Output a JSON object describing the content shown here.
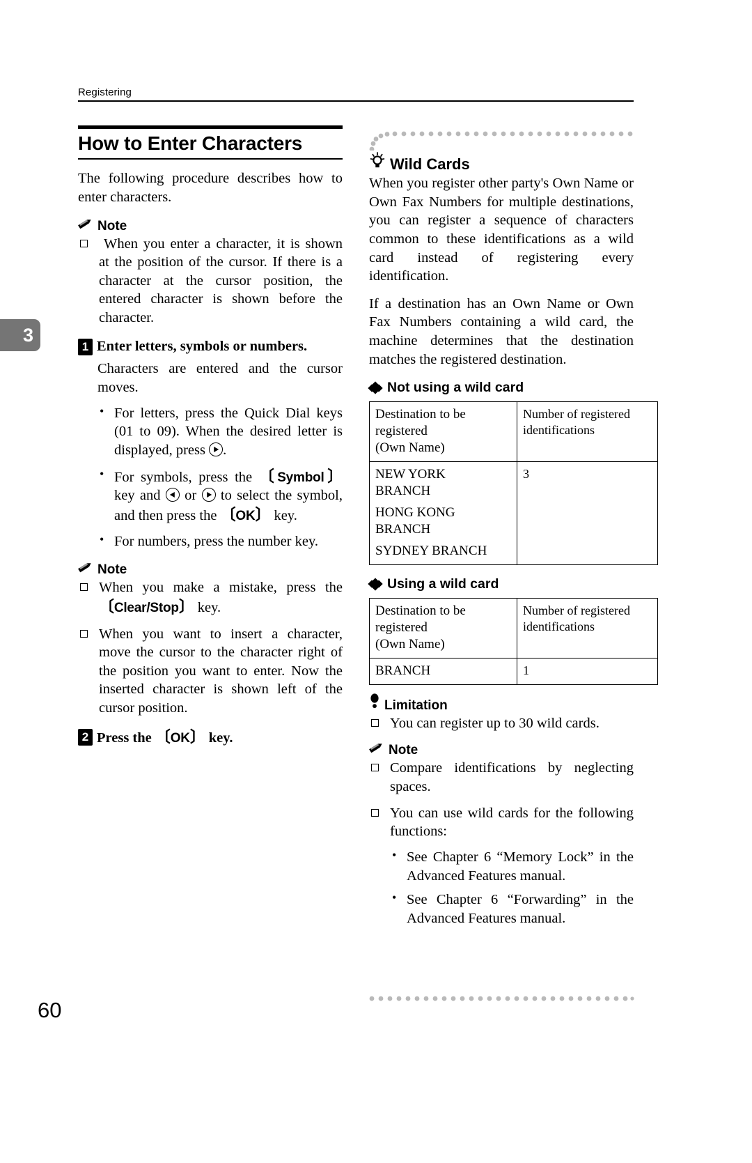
{
  "page": {
    "running_header": "Registering",
    "chapter_tab": "3",
    "folio": "60"
  },
  "left_column": {
    "section_title": "How to Enter Characters",
    "intro": "The following procedure describes how to enter characters.",
    "note1": {
      "label": "Note",
      "icon": "pencil-icon",
      "items": [
        "When you enter a character, it is shown at the position of the cursor. If there is a character at the cursor position, the entered character is shown before the character."
      ]
    },
    "step1": {
      "number": "1",
      "title": "Enter letters, symbols or numbers.",
      "body": "Characters are entered and the cursor moves.",
      "bullets": [
        {
          "part1": "For letters, press the Quick Dial keys (01 to 09). When the desired letter is displayed, press ",
          "icon": "circled-right-arrow-icon",
          "part2": "."
        },
        {
          "part1": "For symbols, press the ",
          "key1": "Symbol",
          "part2": " key and ",
          "icon1": "circled-left-arrow-icon",
          "part3": " or ",
          "icon2": "circled-right-arrow-icon",
          "part4": " to select the symbol, and then press the ",
          "key2": "OK",
          "part5": " key."
        },
        {
          "part1": "For numbers, press the number key."
        }
      ]
    },
    "note2": {
      "label": "Note",
      "icon": "pencil-icon",
      "items": [
        {
          "part1": "When you make a mistake, press the ",
          "key": "Clear/Stop",
          "part2": " key."
        },
        {
          "part1": "When you want to insert a character, move the cursor to the character right of the position you want to enter. Now the inserted character is shown left of the cursor position."
        }
      ]
    },
    "step2": {
      "number": "2",
      "title_part1": "Press the ",
      "title_key": "OK",
      "title_part2": " key."
    }
  },
  "right_column": {
    "tip": {
      "icon": "lightbulb-icon",
      "title": "Wild Cards",
      "paragraphs": [
        "When you register other party's Own Name or Own Fax Numbers for multiple destinations, you can register a sequence of characters common to these identifications as a wild card instead of registering every identification.",
        "If a destination has an Own Name or Own Fax Numbers containing a wild card, the machine determines that the destination matches the registered destination."
      ],
      "subsection_not_using": {
        "heading": "Not using a wild card",
        "table": {
          "headers": [
            "Destination to be registered (Own Name)",
            "Number of registered identifications"
          ],
          "header_col1_lines": [
            "Destination to be",
            "registered",
            "(Own Name)"
          ],
          "header_col2_lines": [
            "Number of registered",
            "identifications"
          ],
          "rows": [
            {
              "destination_lines": [
                "NEW YORK",
                "BRANCH",
                "HONG KONG",
                "BRANCH",
                "SYDNEY BRANCH"
              ],
              "count": "3"
            }
          ]
        }
      },
      "subsection_using": {
        "heading": "Using a wild card",
        "table": {
          "header_col1_lines": [
            "Destination to be",
            "registered",
            "(Own Name)"
          ],
          "header_col2_lines": [
            "Number of registered",
            "identifications"
          ],
          "rows": [
            {
              "destination_lines": [
                "BRANCH"
              ],
              "count": "1"
            }
          ]
        }
      },
      "limitation": {
        "icon": "exclamation-icon",
        "label": "Limitation",
        "items": [
          "You can register up to 30 wild cards."
        ]
      },
      "note": {
        "icon": "pencil-icon",
        "label": "Note",
        "items": [
          "Compare identifications by neglecting spaces.",
          "You can use wild cards for the following functions:"
        ],
        "sub_bullets": [
          "See Chapter 6 “Memory Lock” in the Advanced Features manual.",
          "See Chapter 6 “Forwarding” in the Advanced Features manual."
        ]
      }
    }
  }
}
